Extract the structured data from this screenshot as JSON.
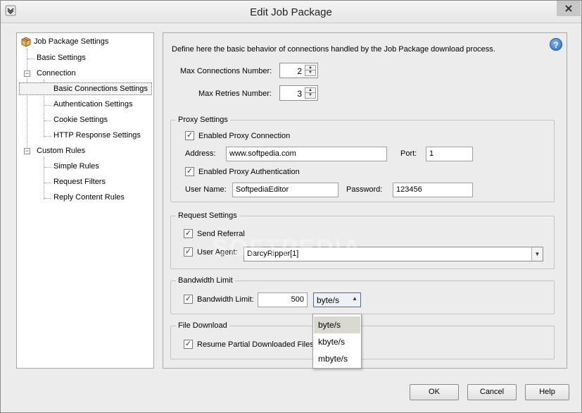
{
  "window": {
    "title": "Edit Job Package"
  },
  "tree": {
    "items": [
      {
        "label": "Job Package Settings"
      },
      {
        "label": "Basic Settings"
      },
      {
        "label": "Connection"
      },
      {
        "label": "Basic Connections Settings"
      },
      {
        "label": "Authentication Settings"
      },
      {
        "label": "Cookie Settings"
      },
      {
        "label": "HTTP Response Settings"
      },
      {
        "label": "Custom Rules"
      },
      {
        "label": "Simple Rules"
      },
      {
        "label": "Request Filters"
      },
      {
        "label": "Reply Content Rules"
      }
    ]
  },
  "panel": {
    "description": "Define here the basic behavior of connections handled by the Job Package download process.",
    "help_glyph": "?",
    "max_connections": {
      "label": "Max Connections Number:",
      "value": "2"
    },
    "max_retries": {
      "label": "Max Retries Number:",
      "value": "3"
    },
    "proxy": {
      "title": "Proxy Settings",
      "enabled_label": "Enabled Proxy Connection",
      "address_label": "Address:",
      "address_value": "www.softpedia.com",
      "port_label": "Port:",
      "port_value": "1",
      "auth_label": "Enabled Proxy Authentication",
      "username_label": "User Name:",
      "username_value": "SoftpediaEditor",
      "password_label": "Password:",
      "password_value": "123456"
    },
    "request": {
      "title": "Request Settings",
      "send_referral_label": "Send Referral",
      "user_agent_label": "User Agent:",
      "user_agent_value": "DarcyRipper[1]"
    },
    "bandwidth": {
      "title": "Bandwidth Limit",
      "limit_label": "Bandwidth Limit:",
      "limit_value": "500",
      "unit_value": "byte/s",
      "unit_options": [
        "byte/s",
        "kbyte/s",
        "mbyte/s"
      ]
    },
    "file_download": {
      "title": "File Download",
      "resume_label": "Resume Partial Downloaded Files"
    }
  },
  "buttons": {
    "ok": "OK",
    "cancel": "Cancel",
    "help": "Help"
  },
  "watermark": "SOFTPEDIA"
}
